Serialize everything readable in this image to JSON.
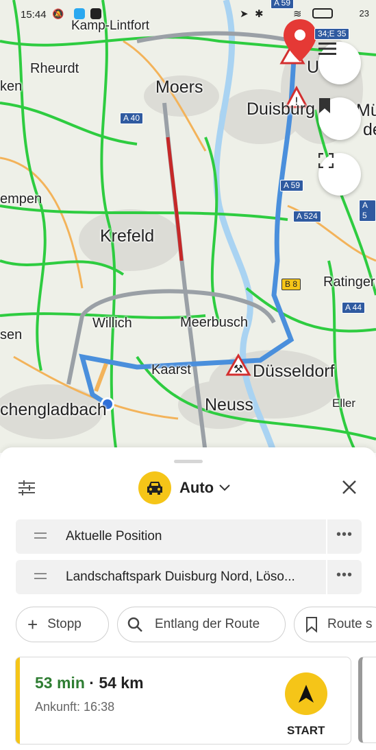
{
  "status_bar": {
    "time": "15:44",
    "right": "23"
  },
  "map": {
    "places": [
      {
        "name": "Kamp-Lintfort",
        "size": "small"
      },
      {
        "name": "Rheurdt",
        "size": "small"
      },
      {
        "name": "Moers",
        "size": "large"
      },
      {
        "name": "Duisburg",
        "size": "large"
      },
      {
        "name": "ken",
        "size": "small"
      },
      {
        "name": "empen",
        "size": "small"
      },
      {
        "name": "Krefeld",
        "size": "large"
      },
      {
        "name": "Willich",
        "size": "small"
      },
      {
        "name": "Meerbusch",
        "size": "small"
      },
      {
        "name": "Ratinger",
        "size": "small"
      },
      {
        "name": "sen",
        "size": "small"
      },
      {
        "name": "Kaarst",
        "size": "small"
      },
      {
        "name": "Düsseldorf",
        "size": "large"
      },
      {
        "name": "Neuss",
        "size": "large"
      },
      {
        "name": "Eller",
        "size": "small"
      },
      {
        "name": "chengladbach",
        "size": "large"
      },
      {
        "name": "Mül",
        "size": "large"
      },
      {
        "name": "de",
        "size": "large"
      },
      {
        "name": "U",
        "size": "large"
      }
    ],
    "road_badges": [
      "A 40",
      "A 59",
      "A 524",
      "B 8",
      "A 44",
      "A 59",
      "34;E 35",
      "A 5"
    ]
  },
  "panel": {
    "mode_label": "Auto",
    "start_field": "Aktuelle Position",
    "destination_field": "Landschaftspark Duisburg Nord, Löso...",
    "more_label": "•••",
    "chips": {
      "stop": "Stopp",
      "along_route": "Entlang der Route",
      "save_route": "Route s"
    },
    "route": {
      "duration": "53 min",
      "separator": "·",
      "distance": "54 km",
      "arrival": "Ankunft: 16:38",
      "start_label": "START"
    }
  },
  "colors": {
    "accent_yellow": "#f5c518",
    "duration_green": "#2e7d32",
    "route_blue": "#4a8fdc",
    "traffic_green": "#2ecc40"
  }
}
